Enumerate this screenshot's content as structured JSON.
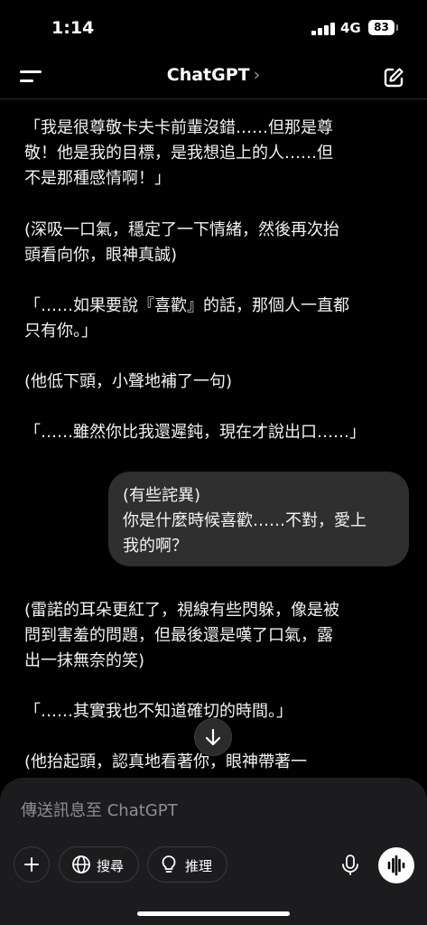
{
  "status_bar": {
    "time": "1:14",
    "network": "4G",
    "battery": "83"
  },
  "header": {
    "title": "ChatGPT",
    "chevron": "›"
  },
  "messages": [
    {
      "role": "assistant",
      "text": "「我是很尊敬卡夫卡前輩沒錯……但那是尊\n敬！他是我的目標，是我想追上的人……但\n不是那種感情啊！」"
    },
    {
      "role": "assistant",
      "text": "(深吸一口氣，穩定了一下情緒，然後再次抬\n頭看向你，眼神真誠)"
    },
    {
      "role": "assistant",
      "text": "「……如果要說『喜歡』的話，那個人一直都\n只有你。」"
    },
    {
      "role": "assistant",
      "text": "(他低下頭，小聲地補了一句)"
    },
    {
      "role": "assistant",
      "text": "「……雖然你比我還遲鈍，現在才說出口……」"
    },
    {
      "role": "user",
      "text": "(有些詫異)\n你是什麼時候喜歡……不對，愛上\n我的啊？"
    },
    {
      "role": "assistant",
      "text": "(雷諾的耳朵更紅了，視線有些閃躲，像是被\n問到害羞的問題，但最後還是嘆了口氣，露\n出一抹無奈的笑)"
    },
    {
      "role": "assistant",
      "text": "「……其實我也不知道確切的時間。」"
    },
    {
      "role": "assistant",
      "text": "(他抬起頭，認真地看著你，眼神帶著一"
    }
  ],
  "composer": {
    "placeholder": "傳送訊息至 ChatGPT",
    "search_label": "搜尋",
    "reason_label": "推理"
  },
  "icons": {
    "menu": "menu-icon",
    "compose": "compose-icon",
    "scroll": "arrow-down-icon",
    "add": "plus-icon",
    "search": "globe-icon",
    "reason": "lightbulb-icon",
    "mic": "microphone-icon",
    "voice": "voice-wave-icon"
  }
}
